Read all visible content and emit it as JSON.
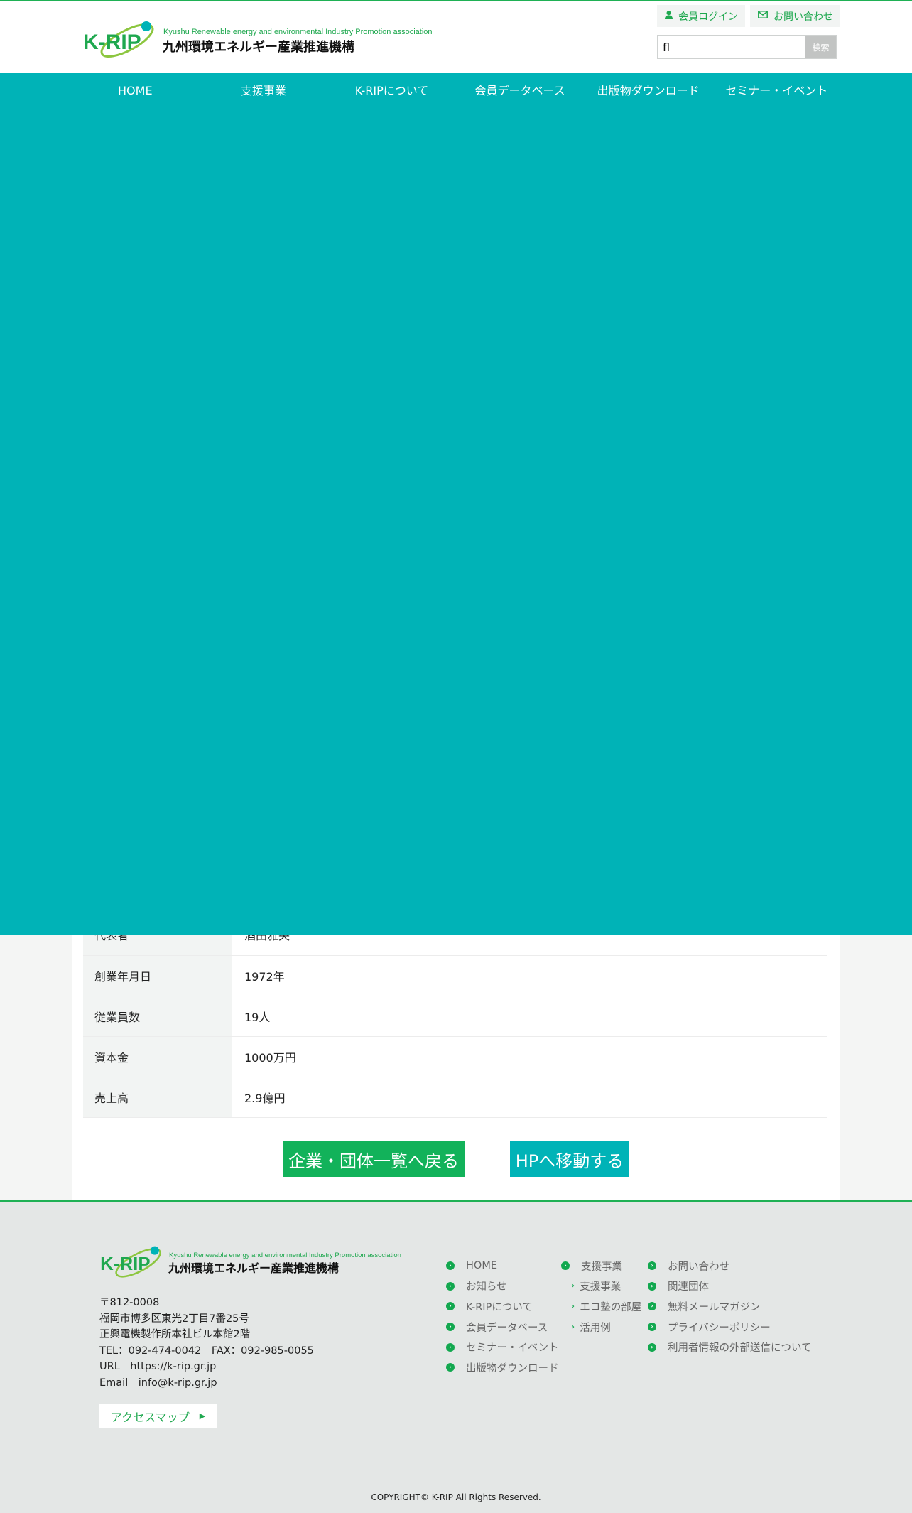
{
  "header": {
    "logo_mark": "K-RIP",
    "logo_en": "Kyushu Renewable energy and environmental Industry Promotion association",
    "logo_jp": "九州環境エネルギー産業推進機構",
    "login_label": "会員ログイン",
    "contact_label": "お問い合わせ",
    "search_value": "fl",
    "search_button": "検索",
    "icons": {
      "login": "user-icon",
      "contact": "envelope-icon"
    }
  },
  "nav": {
    "items": [
      "HOME",
      "支援事業",
      "K-RIPについて",
      "会員データベース",
      "出版物ダウンロード",
      "セミナー・イベント"
    ]
  },
  "table": {
    "partial_row": {
      "key": "代表者",
      "value": "酒田雅央"
    },
    "rows": [
      {
        "key": "創業年月日",
        "value": "1972年"
      },
      {
        "key": "従業員数",
        "value": "19人"
      },
      {
        "key": "資本金",
        "value": "1000万円"
      },
      {
        "key": "売上高",
        "value": "2.9億円"
      }
    ]
  },
  "actions": {
    "back_label": "企業・団体一覧へ戻る",
    "hp_label": "HPへ移動する"
  },
  "footer": {
    "logo_mark": "K-RIP",
    "logo_en": "Kyushu Renewable energy and environmental Industry Promotion association",
    "logo_jp": "九州環境エネルギー産業推進機構",
    "address_lines": [
      "〒812-0008",
      "福岡市博多区東光2丁目7番25号",
      "正興電機製作所本社ビル本館2階",
      "TEL：092-474-0042　FAX：092-985-0055",
      "URL　https://k-rip.gr.jp",
      "Email　info@k-rip.gr.jp"
    ],
    "map_label": "アクセスマップ",
    "col1": [
      "HOME",
      "お知らせ",
      "K-RIPについて",
      "会員データベース",
      "セミナー・イベント",
      "出版物ダウンロード"
    ],
    "col2_head": "支援事業",
    "col2_sub": [
      "支援事業",
      "エコ塾の部屋",
      "活用例"
    ],
    "col3": [
      "お問い合わせ",
      "関連団体",
      "無料メールマガジン",
      "プライバシーポリシー",
      "利用者情報の外部送信について"
    ],
    "copyright": "COPYRIGHT© K-RIP All Rights Reserved."
  },
  "colors": {
    "brand_green": "#1fb155",
    "teal": "#00b3b7"
  }
}
